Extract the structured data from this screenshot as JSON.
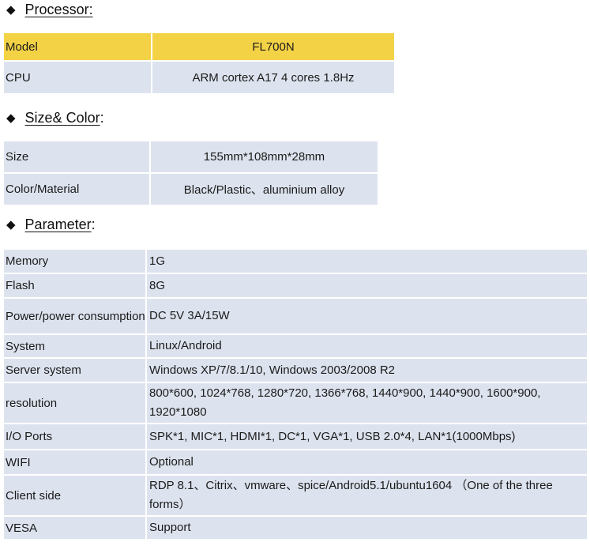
{
  "sections": [
    {
      "title": "Processor:"
    },
    {
      "title": "Size& Color",
      "suffix": ":"
    },
    {
      "title": "Parameter",
      "suffix": ":"
    }
  ],
  "processor": [
    {
      "key": "Model",
      "value": "FL700N"
    },
    {
      "key": "CPU",
      "value": "ARM cortex A17 4 cores 1.8Hz"
    }
  ],
  "size_color": [
    {
      "key": "Size",
      "value": "155mm*108mm*28mm"
    },
    {
      "key": "Color/Material",
      "value": "Black/Plastic、aluminium alloy"
    }
  ],
  "parameter": [
    {
      "key": "Memory",
      "value": "1G"
    },
    {
      "key": "Flash",
      "value": "8G"
    },
    {
      "key": "Power/power consumption",
      "value": "DC 5V 3A/15W"
    },
    {
      "key": "System",
      "value": "Linux/Android"
    },
    {
      "key": "Server system",
      "value": "Windows XP/7/8.1/10,  Windows 2003/2008 R2"
    },
    {
      "key": "resolution",
      "value": "800*600,  1024*768, 1280*720, 1366*768, 1440*900,  1440*900, 1600*900, 1920*1080"
    },
    {
      "key": "I/O Ports",
      "value": "SPK*1,  MIC*1,  HDMI*1, DC*1, VGA*1,  USB 2.0*4,  LAN*1(1000Mbps)"
    },
    {
      "key": "WIFI",
      "value": "Optional"
    },
    {
      "key": "Client side",
      "value": "RDP 8.1、Citrix、vmware、spice/Android5.1/ubuntu1604  （One of the three forms）"
    },
    {
      "key": "VESA",
      "value": "Support"
    }
  ],
  "colors": {
    "highlight": "#f4d246",
    "row": "#dde3ee"
  }
}
